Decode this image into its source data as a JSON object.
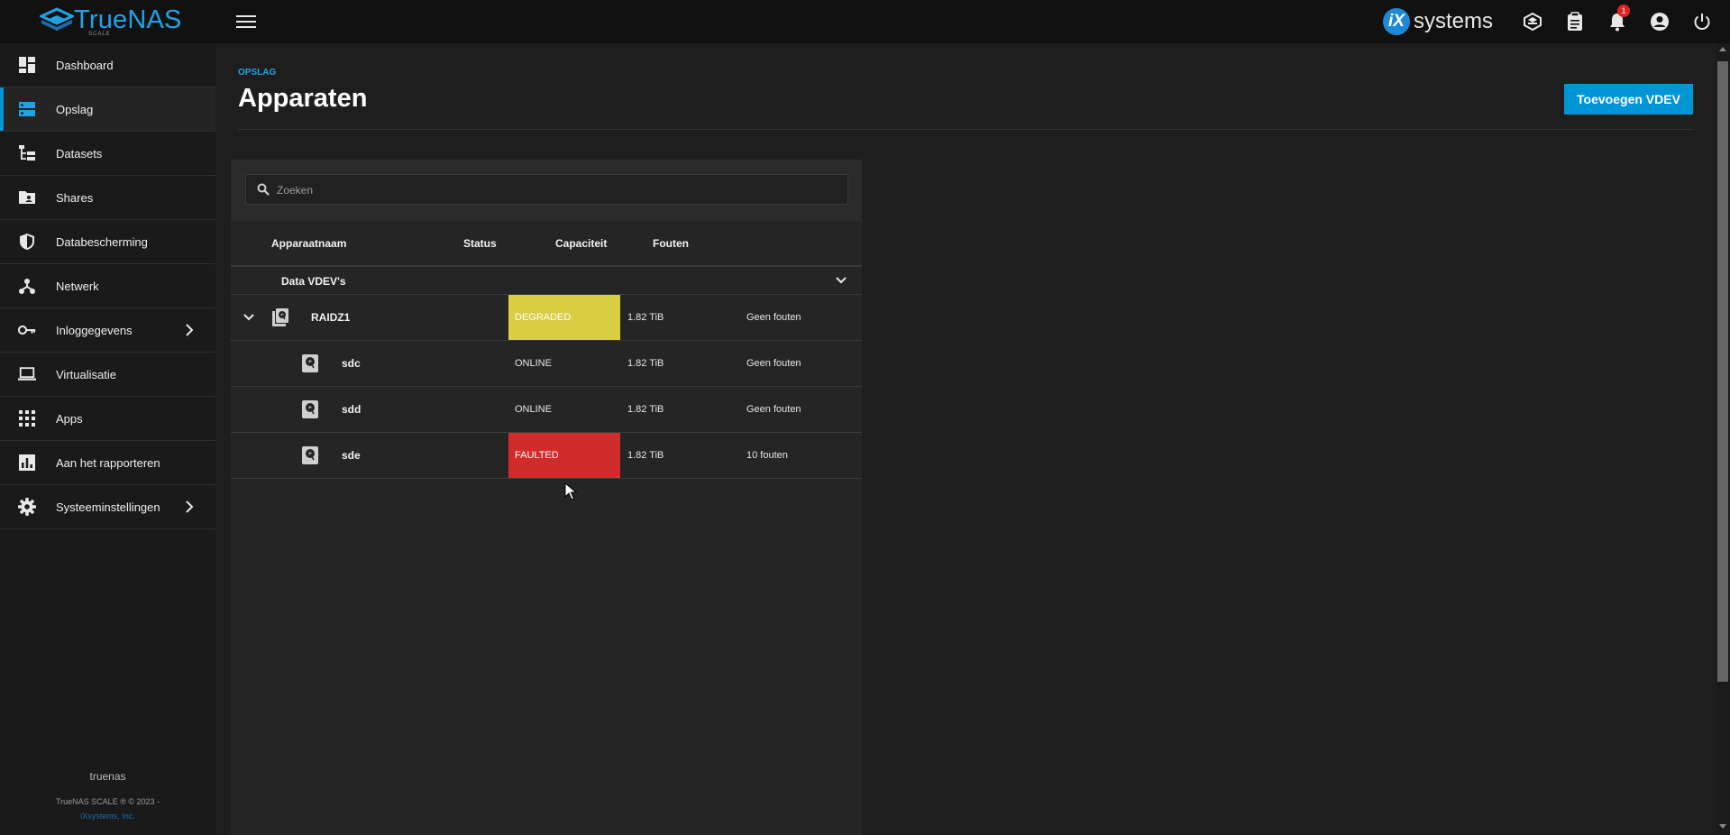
{
  "header": {
    "brand": "TrueNAS",
    "brand_sub": "SCALE",
    "vendor_mark": "iX",
    "vendor": "systems",
    "notification_count": "1"
  },
  "sidebar": {
    "items": [
      {
        "label": "Dashboard",
        "icon": "dashboard-icon"
      },
      {
        "label": "Opslag",
        "icon": "storage-icon",
        "active": true
      },
      {
        "label": "Datasets",
        "icon": "datasets-icon"
      },
      {
        "label": "Shares",
        "icon": "shares-folder-icon"
      },
      {
        "label": "Databescherming",
        "icon": "shield-icon"
      },
      {
        "label": "Netwerk",
        "icon": "network-icon"
      },
      {
        "label": "Inloggegevens",
        "icon": "key-icon",
        "expandable": true
      },
      {
        "label": "Virtualisatie",
        "icon": "laptop-icon"
      },
      {
        "label": "Apps",
        "icon": "apps-grid-icon"
      },
      {
        "label": "Aan het rapporteren",
        "icon": "bar-chart-icon"
      },
      {
        "label": "Systeeminstellingen",
        "icon": "gear-icon",
        "expandable": true
      }
    ],
    "hostname": "truenas",
    "copyright": "TrueNAS SCALE ® © 2023 -",
    "company": "iXsystems, Inc."
  },
  "main": {
    "breadcrumb": "OPSLAG",
    "title": "Apparaten",
    "add_button": "Toevoegen VDEV",
    "search_placeholder": "Zoeken",
    "columns": [
      "Apparaatnaam",
      "Status",
      "Capaciteit",
      "Fouten"
    ],
    "group_label": "Data VDEV's",
    "rows": [
      {
        "name": "RAIDZ1",
        "status": "DEGRADED",
        "capacity": "1.82 TiB",
        "errors": "Geen fouten"
      },
      {
        "name": "sdc",
        "status": "ONLINE",
        "capacity": "1.82 TiB",
        "errors": "Geen fouten"
      },
      {
        "name": "sdd",
        "status": "ONLINE",
        "capacity": "1.82 TiB",
        "errors": "Geen fouten"
      },
      {
        "name": "sde",
        "status": "FAULTED",
        "capacity": "1.82 TiB",
        "errors": "10 fouten"
      }
    ]
  },
  "colors": {
    "accent": "#0095d5",
    "degraded": "#d9cd44",
    "faulted": "#d22b2b"
  }
}
